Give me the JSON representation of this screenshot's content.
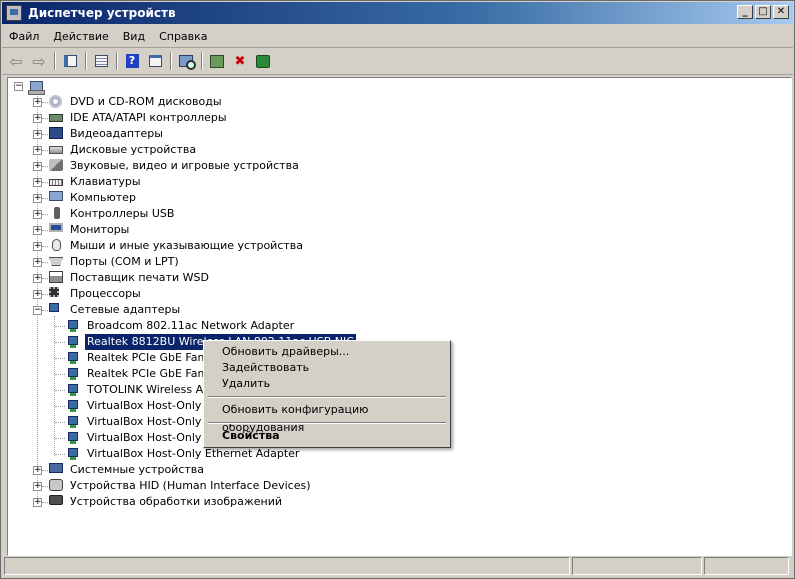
{
  "window": {
    "title": "Диспетчер устройств",
    "controls": {
      "minimize": "_",
      "maximize": "□",
      "close": "✕"
    }
  },
  "menu": [
    "Файл",
    "Действие",
    "Вид",
    "Справка"
  ],
  "toolbar": {
    "buttons": [
      {
        "name": "back-icon",
        "glyph": "⇦"
      },
      {
        "name": "forward-icon",
        "glyph": "⇨"
      },
      {
        "name": "show-hide-console-tree-icon"
      },
      {
        "name": "properties-icon"
      },
      {
        "name": "help-icon",
        "glyph": "?"
      },
      {
        "name": "view-icon"
      },
      {
        "name": "scan-hardware-icon"
      },
      {
        "name": "update-driver-icon"
      },
      {
        "name": "uninstall-device-icon"
      },
      {
        "name": "enable-device-icon"
      }
    ]
  },
  "tree": {
    "categories_top": [
      {
        "label": "DVD и CD-ROM дисководы",
        "icon": "dvd-drive-icon"
      },
      {
        "label": "IDE ATA/ATAPI контроллеры",
        "icon": "ide-controller-icon"
      },
      {
        "label": "Видеоадаптеры",
        "icon": "display-adapter-icon"
      },
      {
        "label": "Дисковые устройства",
        "icon": "disk-drive-icon"
      },
      {
        "label": "Звуковые, видео и игровые устройства",
        "icon": "sound-device-icon"
      },
      {
        "label": "Клавиатуры",
        "icon": "keyboard-icon"
      },
      {
        "label": "Компьютер",
        "icon": "computer-icon"
      },
      {
        "label": "Контроллеры USB",
        "icon": "usb-icon"
      },
      {
        "label": "Мониторы",
        "icon": "monitor-icon"
      },
      {
        "label": "Мыши и иные указывающие устройства",
        "icon": "mouse-icon"
      },
      {
        "label": "Порты (COM и LPT)",
        "icon": "port-icon"
      },
      {
        "label": "Поставщик печати WSD",
        "icon": "printer-icon"
      },
      {
        "label": "Процессоры",
        "icon": "processor-icon"
      },
      {
        "label": "Сетевые адаптеры",
        "icon": "network-adapter-icon"
      }
    ],
    "network_children": [
      "Broadcom 802.11ac Network Adapter",
      "Realtek 8812BU Wireless LAN 802.11ac USB NIC",
      "Realtek PCIe GbE Family Controller",
      "Realtek PCIe GbE Family Controller #2",
      "TOTOLINK Wireless Adapter",
      "VirtualBox Host-Only Ethernet Adapter #2",
      "VirtualBox Host-Only Ethernet Adapter #3",
      "VirtualBox Host-Only Ethernet Adapter #4",
      "VirtualBox Host-Only Ethernet Adapter"
    ],
    "selected_child_index": 1,
    "categories_bottom": [
      {
        "label": "Системные устройства",
        "icon": "system-device-icon"
      },
      {
        "label": "Устройства HID (Human Interface Devices)",
        "icon": "hid-icon"
      },
      {
        "label": "Устройства обработки изображений",
        "icon": "imaging-device-icon"
      }
    ]
  },
  "context_menu": {
    "update_drivers": "Обновить драйверы...",
    "enable": "Задействовать",
    "delete": "Удалить",
    "scan": "Обновить конфигурацию оборудования",
    "properties": "Свойства"
  },
  "colors": {
    "selection": "#0a246a",
    "title_start": "#0a246a",
    "title_end": "#a6caf0"
  }
}
